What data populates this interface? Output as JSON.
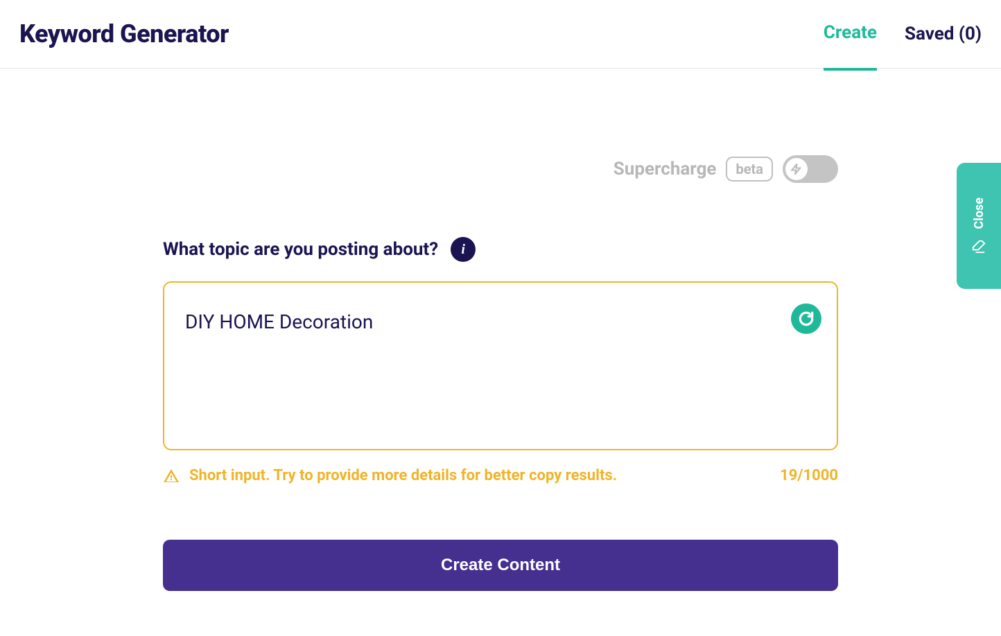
{
  "header": {
    "title": "Keyword Generator",
    "tabs": {
      "create": "Create",
      "saved": "Saved (0)"
    }
  },
  "supercharge": {
    "label": "Supercharge",
    "badge": "beta"
  },
  "prompt": {
    "question": "What topic are you posting about?",
    "info_glyph": "i"
  },
  "input": {
    "value": "DIY HOME Decoration"
  },
  "warning": {
    "message": "Short input. Try to provide more details for better copy results.",
    "count": "19/1000"
  },
  "buttons": {
    "create_content": "Create Content"
  },
  "side": {
    "close": "Close"
  }
}
